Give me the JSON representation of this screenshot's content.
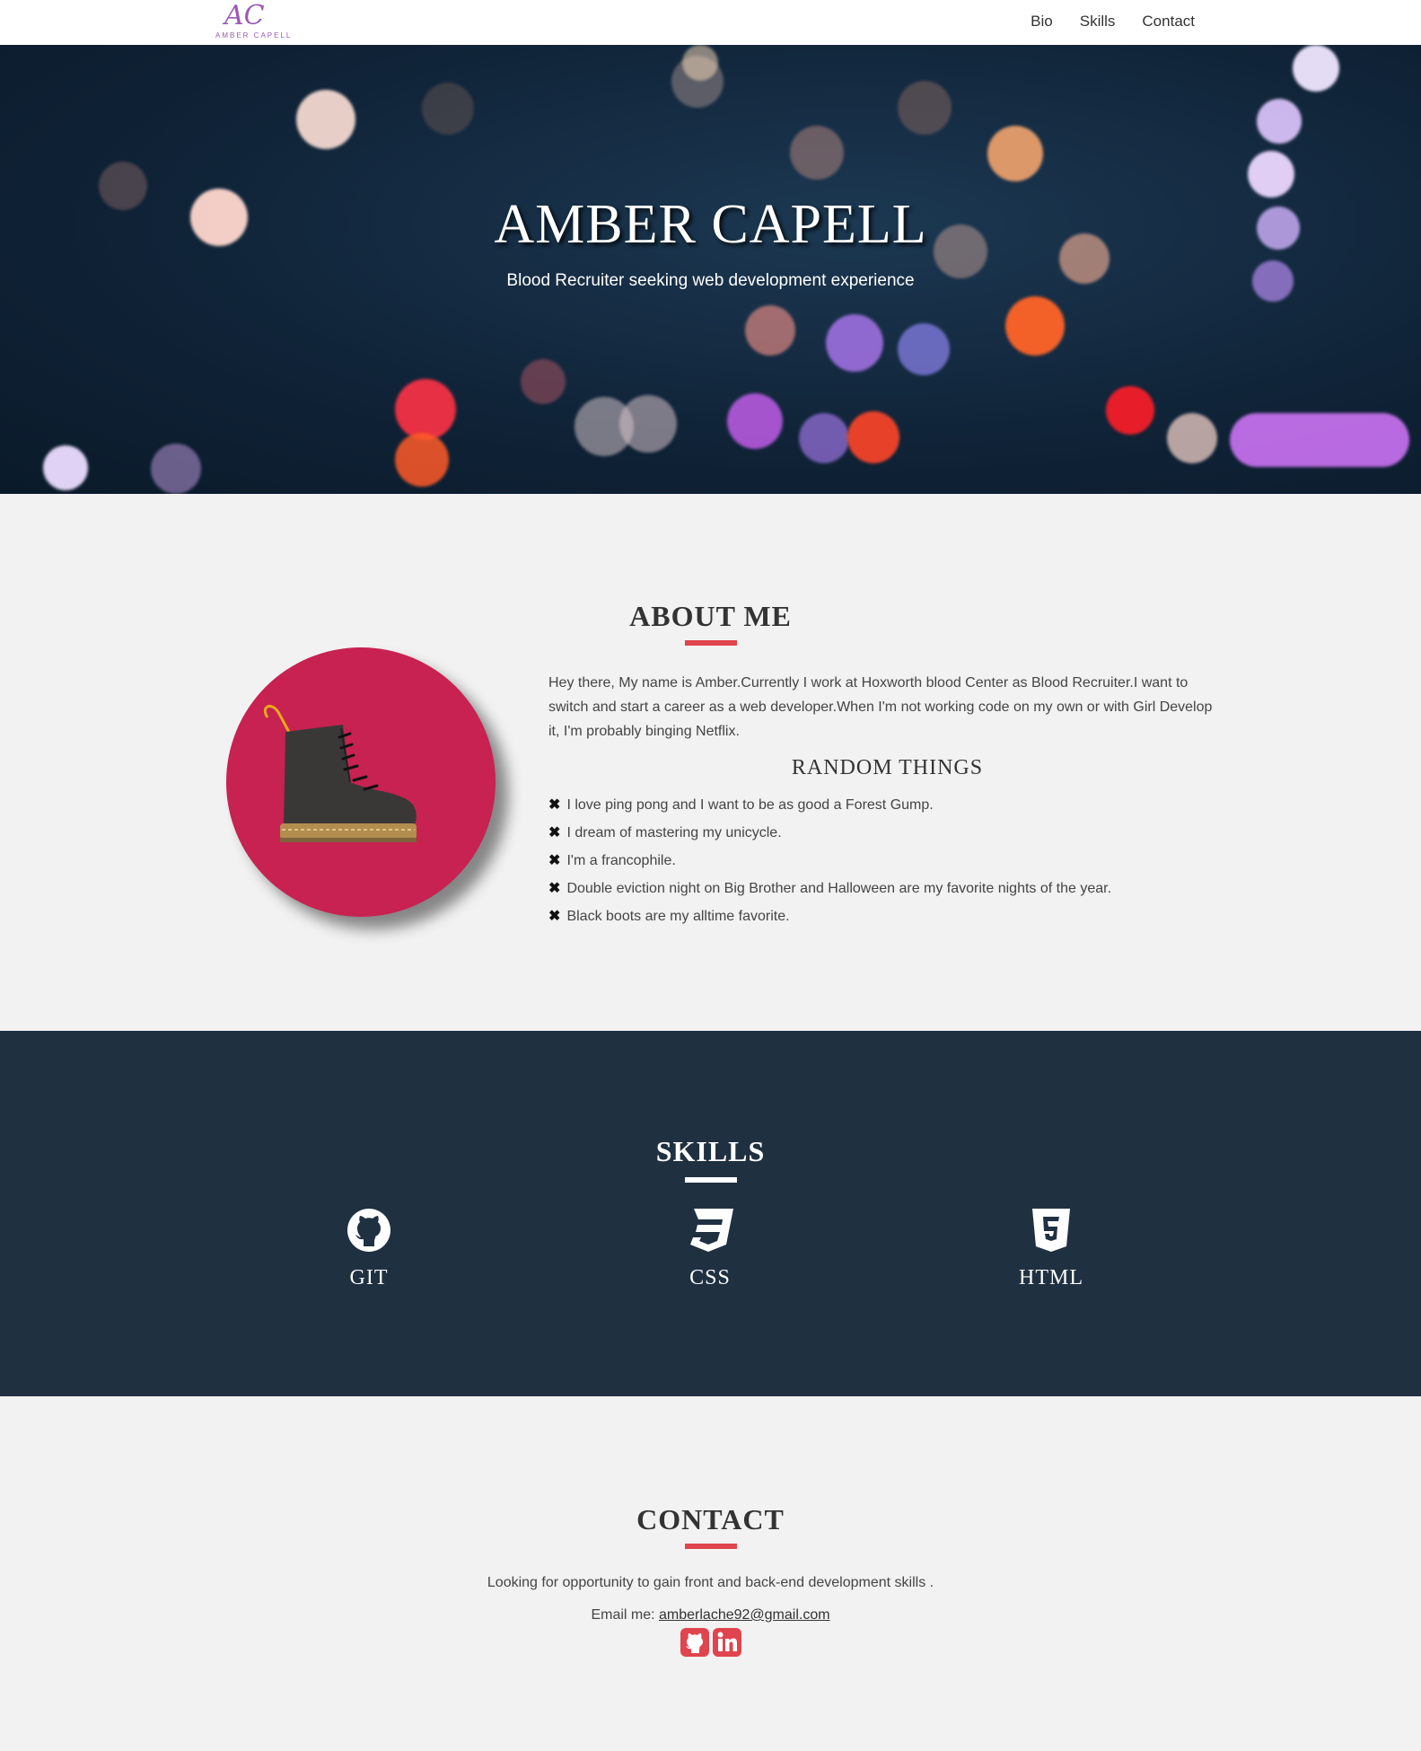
{
  "nav": {
    "logo_mark": "AC",
    "logo_text": "AMBER CAPELL",
    "links": [
      "Bio",
      "Skills",
      "Contact"
    ]
  },
  "hero": {
    "title": "AMBER CAPELL",
    "subtitle": "Blood Recruiter seeking web development experience"
  },
  "about": {
    "title": "ABOUT ME",
    "bio": "Hey there, My name is Amber.Currently I work at Hoxworth blood Center as Blood Recruiter.I want to switch and start a career as a web developer.When I'm not working code on my own or with Girl Develop it, I'm probably binging Netflix.",
    "random_title": "RANDOM THINGS",
    "random_things": [
      "I love ping pong and I want to be as good a Forest Gump.",
      "I dream of mastering my unicycle.",
      "I'm a francophile.",
      "Double eviction night on Big Brother and Halloween are my favorite nights of the year.",
      "Black boots are my alltime favorite."
    ],
    "avatar_icon": "boot-icon"
  },
  "skills": {
    "title": "SKILLS",
    "items": [
      {
        "label": "GIT",
        "icon": "github-icon"
      },
      {
        "label": "CSS",
        "icon": "css3-icon"
      },
      {
        "label": "HTML",
        "icon": "html5-icon"
      }
    ]
  },
  "contact": {
    "title": "CONTACT",
    "text": "Looking for opportunity to gain front and back-end development skills .",
    "email_label": "Email me:",
    "email": "amberlache92@gmail.com",
    "social": [
      "github-square-icon",
      "linkedin-square-icon"
    ]
  },
  "colors": {
    "accent": "#e0444e",
    "navy": "#1f3041",
    "avatar_bg": "#c72251",
    "logo": "#9b59b6",
    "page_bg": "#f2f2f2"
  }
}
